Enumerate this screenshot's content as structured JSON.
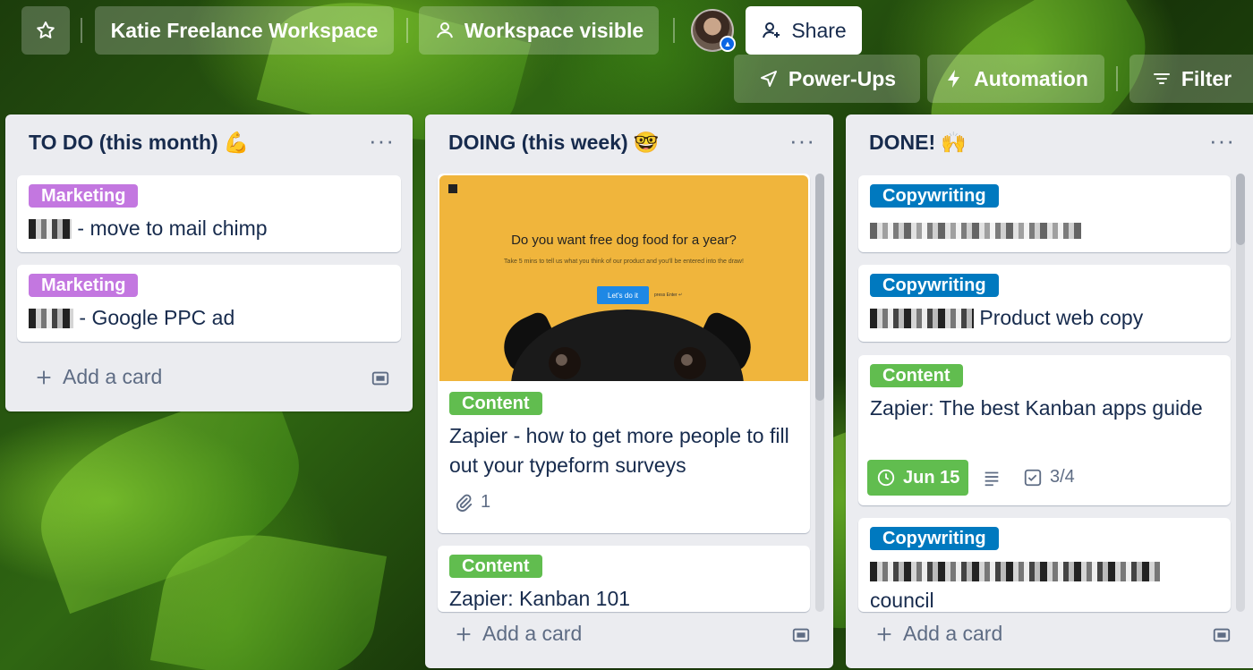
{
  "header": {
    "workspace_name": "Katie Freelance Workspace",
    "visibility_label": "Workspace visible",
    "share_label": "Share",
    "powerups_label": "Power-Ups",
    "automation_label": "Automation",
    "filter_label": "Filter"
  },
  "lists": [
    {
      "title": "TO DO (this month)",
      "emoji": "💪",
      "add_card": "Add a card",
      "cards": [
        {
          "label": "Marketing",
          "label_color": "#c377e0",
          "title_suffix": "- move to mail chimp"
        },
        {
          "label": "Marketing",
          "label_color": "#c377e0",
          "title_suffix": "- Google PPC ad"
        }
      ]
    },
    {
      "title": "DOING (this week)",
      "emoji": "🤓",
      "add_card": "Add a card",
      "cards": [
        {
          "cover": {
            "headline": "Do you want free dog food for a year?",
            "subtext": "Take 5 mins to tell us what you think of our product and you'll be entered into the draw!",
            "cta": "Let's do it",
            "cta_note": "press Enter ↵"
          },
          "label": "Content",
          "label_color": "#61bd4f",
          "title": "Zapier - how to get more people to fill out your typeform surveys",
          "attachments": "1"
        },
        {
          "label": "Content",
          "label_color": "#61bd4f",
          "title": "Zapier: Kanban 101"
        }
      ]
    },
    {
      "title": "DONE!",
      "emoji": "🙌",
      "add_card": "Add a card",
      "cards": [
        {
          "label": "Copywriting",
          "label_color": "#0079bf"
        },
        {
          "label": "Copywriting",
          "label_color": "#0079bf",
          "title_suffix": "Product web copy"
        },
        {
          "label": "Content",
          "label_color": "#61bd4f",
          "title": "Zapier: The best Kanban apps guide",
          "due": "Jun 15",
          "checklist": "3/4"
        },
        {
          "label": "Copywriting",
          "label_color": "#0079bf",
          "title_suffix": "council"
        }
      ]
    }
  ]
}
